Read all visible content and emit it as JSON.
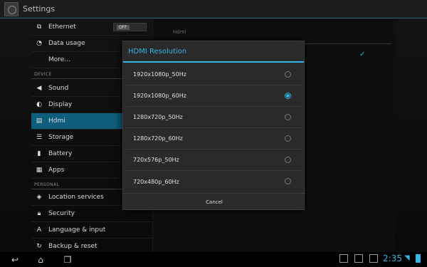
{
  "actionbar": {
    "title": "Settings"
  },
  "settings": {
    "items": [
      {
        "label": "Ethernet",
        "icon": "network-icon",
        "toggle": "OFF"
      },
      {
        "label": "Data usage",
        "icon": "data-usage-icon"
      },
      {
        "label": "More…",
        "icon": ""
      }
    ],
    "device_header": "DEVICE",
    "device_items": [
      {
        "label": "Sound",
        "icon": "volume-icon"
      },
      {
        "label": "Display",
        "icon": "brightness-icon"
      },
      {
        "label": "Hdmi",
        "icon": "hdmi-icon",
        "selected": true
      },
      {
        "label": "Storage",
        "icon": "storage-icon"
      },
      {
        "label": "Battery",
        "icon": "battery-icon"
      },
      {
        "label": "Apps",
        "icon": "apps-icon"
      }
    ],
    "personal_header": "PERSONAL",
    "personal_items": [
      {
        "label": "Location services",
        "icon": "location-icon"
      },
      {
        "label": "Security",
        "icon": "lock-icon"
      },
      {
        "label": "Language & input",
        "icon": "language-icon"
      },
      {
        "label": "Backup & reset",
        "icon": "backup-icon"
      }
    ]
  },
  "right_pane": {
    "title": "Hdmi"
  },
  "dialog": {
    "title": "HDMI Resolution",
    "options": [
      {
        "label": "1920x1080p_50Hz",
        "checked": false
      },
      {
        "label": "1920x1080p_60Hz",
        "checked": true
      },
      {
        "label": "1280x720p_50Hz",
        "checked": false
      },
      {
        "label": "1280x720p_60Hz",
        "checked": false
      },
      {
        "label": "720x576p_50Hz",
        "checked": false
      },
      {
        "label": "720x480p_60Hz",
        "checked": false
      }
    ],
    "cancel_label": "Cancel"
  },
  "statusbar": {
    "time": "2:35"
  },
  "colors": {
    "accent": "#33b5e5",
    "selected_row": "#0f5d7c"
  }
}
